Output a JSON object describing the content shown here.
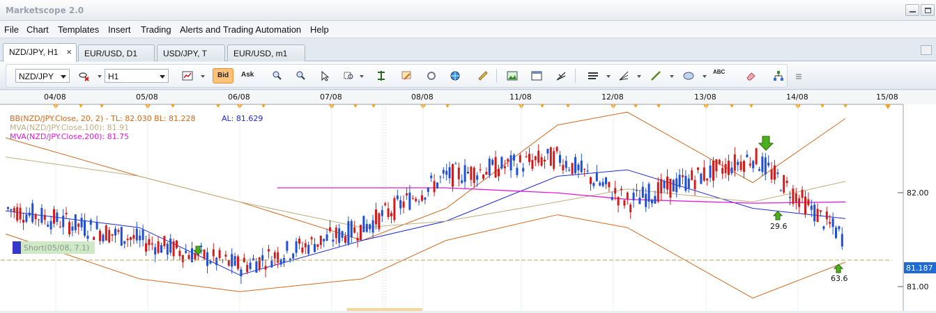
{
  "app": {
    "title": "Marketscope 2.0"
  },
  "menu": [
    "File",
    "Chart",
    "Templates",
    "Insert",
    "Trading",
    "Alerts and Trading Automation",
    "Help"
  ],
  "tabs": [
    {
      "label": "NZD/JPY, H1",
      "active": true,
      "close": "×"
    },
    {
      "label": "EUR/USD, D1",
      "active": false
    },
    {
      "label": "USD/JPY, T",
      "active": false
    },
    {
      "label": "EUR/USD, m1",
      "active": false
    }
  ],
  "toolbar": {
    "instrument": "NZD/JPY",
    "timeframe": "H1",
    "bid_label": "Bid",
    "ask_label": "Ask",
    "text_tool_label": "ABC",
    "icons": [
      "line-chart-icon",
      "link-remove-icon",
      "zoom-in-icon",
      "zoom-out-icon",
      "cursor-icon",
      "zoom-rect-icon",
      "crosshair-icon",
      "edit-icon",
      "refresh-icon",
      "globe-icon",
      "ruler-icon",
      "image-icon",
      "window-icon",
      "fork-tool-icon",
      "lines-icon",
      "fan-icon",
      "trend-line-icon",
      "ellipse-icon",
      "text-icon",
      "eraser-icon",
      "hierarchy-icon",
      "more-icon"
    ],
    "colors": {
      "selected_bg": "#ffc27a",
      "selected_border": "#e4912d"
    }
  },
  "chart": {
    "date_labels": [
      "04/08",
      "05/08",
      "06/08",
      "07/08",
      "08/08",
      "11/08",
      "12/08",
      "13/08",
      "14/08",
      "15/08"
    ],
    "legend": [
      {
        "text": "BB(NZD/JPY.Close, 20, 2) -  TL: 82.030  BL: 81.228",
        "color": "#d2691e"
      },
      {
        "text": "AL: 81.629",
        "color": "#1b2ad6"
      },
      {
        "text": "MVA(NZD/JPY.Close,100): 81.91",
        "color": "#c0ad7f"
      },
      {
        "text": "MVA(NZD/JPY.Close,200): 81.75",
        "color": "#e01ad6"
      }
    ],
    "price_ticks": [
      "82.00",
      "81.00"
    ],
    "current_price": "81.187",
    "short_label": "Short(05/08, 7.1)",
    "signal_labels": [
      "29.6",
      "63.6"
    ],
    "colors": {
      "up_candle": "#1e4fd6",
      "down_candle": "#d21c1c",
      "bb": "#d2691e",
      "mva20": "#1b2ad6",
      "mva100": "#c0ad7f",
      "mva200": "#e01ad6",
      "arrow": "#4caf1e",
      "price_tag": "#1e6ad6"
    }
  },
  "chart_data": {
    "type": "line",
    "title": "",
    "xlabel": "",
    "ylabel": "",
    "categories": [
      "04/08",
      "05/08",
      "06/08",
      "07/08",
      "08/08",
      "11/08",
      "12/08",
      "13/08",
      "14/08"
    ],
    "ylim": [
      80.9,
      82.5
    ],
    "grid": false,
    "legend_placement": "top-left",
    "series": [
      {
        "name": "BB TL",
        "values": [
          82.25,
          81.95,
          81.75,
          81.45,
          81.7,
          82.35,
          82.45,
          81.9,
          82.4
        ]
      },
      {
        "name": "BB BL",
        "values": [
          81.5,
          81.15,
          81.05,
          81.15,
          81.45,
          81.65,
          81.55,
          81.0,
          81.28
        ]
      },
      {
        "name": "AL",
        "values": [
          81.68,
          81.55,
          81.18,
          81.45,
          81.6,
          81.95,
          82.0,
          81.7,
          81.62
        ]
      },
      {
        "name": "MVA(NZD/JPY.Close,100)",
        "values": [
          82.1,
          81.95,
          81.75,
          81.55,
          81.6,
          81.75,
          81.85,
          81.75,
          81.91
        ]
      },
      {
        "name": "MVA(NZD/JPY.Close,200)",
        "values": [
          null,
          null,
          null,
          81.86,
          81.86,
          81.82,
          81.77,
          81.74,
          81.75
        ]
      },
      {
        "name": "Close",
        "values": [
          81.7,
          81.45,
          81.25,
          81.55,
          81.95,
          82.1,
          81.75,
          82.1,
          81.45
        ]
      }
    ]
  }
}
